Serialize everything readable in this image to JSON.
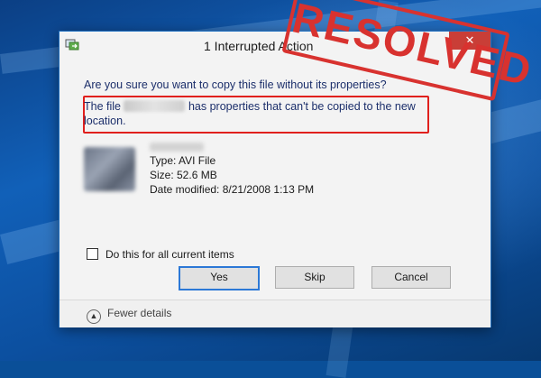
{
  "window": {
    "title": "1 Interrupted Action",
    "close_glyph": "✕"
  },
  "dialog": {
    "question": "Are you sure you want to copy this file without its properties?",
    "message_prefix": "The file",
    "message_suffix": "has properties that can't be copied to the new location.",
    "file": {
      "type": "Type: AVI File",
      "size": "Size: 52.6 MB",
      "date_modified": "Date modified: 8/21/2008 1:13 PM"
    },
    "checkbox_label": "Do this for all current items",
    "buttons": {
      "yes": "Yes",
      "skip": "Skip",
      "cancel": "Cancel"
    },
    "fewer_details": "Fewer details"
  },
  "stamp": {
    "text": "RESOLVED",
    "color": "#d8322f"
  },
  "colors": {
    "highlight_outline": "#e0201d",
    "accent": "#2c78d6"
  }
}
